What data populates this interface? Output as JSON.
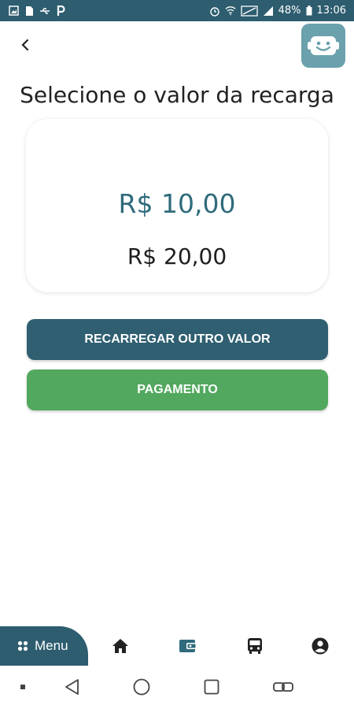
{
  "status_bar": {
    "left_icons": [
      "image-icon",
      "sim-icon",
      "usb-icon",
      "p-icon"
    ],
    "right_icons": [
      "alarm-icon",
      "wifi-icon",
      "no-sim-icon",
      "signal-icon",
      "battery-icon"
    ],
    "battery": "48%",
    "time": "13:06"
  },
  "header": {
    "back_icon": "chevron-left-icon",
    "logo_icon": "smile-logo-icon"
  },
  "page": {
    "title": "Selecione o valor da recarga"
  },
  "amounts": [
    {
      "label": "R$  10,00",
      "selected": true
    },
    {
      "label": "R$  20,00",
      "selected": false
    }
  ],
  "buttons": {
    "other_value": "RECARREGAR OUTRO VALOR",
    "payment": "PAGAMENTO"
  },
  "bottom_nav": {
    "menu_label": "Menu",
    "items": [
      "home-icon",
      "wallet-icon",
      "bus-icon",
      "account-icon"
    ],
    "active": "wallet-icon"
  },
  "system_nav": {
    "items": [
      "dot-icon",
      "back-triangle-icon",
      "home-circle-icon",
      "recents-square-icon",
      "link-icon"
    ]
  },
  "colors": {
    "primary": "#2d5d6f",
    "selected_amount": "#2f6b7c",
    "payment_green": "#52a85e",
    "logo_bg": "#6aa1ad"
  }
}
